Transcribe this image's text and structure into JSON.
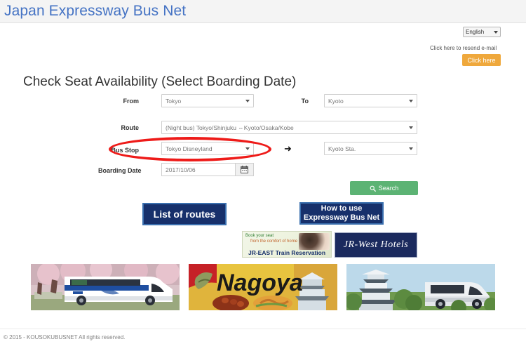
{
  "header": {
    "site_title": "Japan Expressway Bus Net"
  },
  "topbar": {
    "language_selected": "English",
    "resend_text": "Click here to resend e-mail",
    "click_here_label": "Click here"
  },
  "main": {
    "page_title": "Check Seat Availability (Select Boarding Date)"
  },
  "form": {
    "from_label": "From",
    "from_value": "Tokyo",
    "to_label": "To",
    "to_value": "Kyoto",
    "route_label": "Route",
    "route_value": "(Night bus) Tokyo/Shinjuku ⇔Kyoto/Osaka/Kobe",
    "bus_stop_label": "Bus Stop",
    "bus_stop_origin_value": "Tokyo Disneyland",
    "bus_stop_arrow": "➜",
    "bus_stop_dest_value": "Kyoto Sta.",
    "boarding_date_label": "Boarding Date",
    "boarding_date_value": "2017/10/06",
    "calendar_icon": "calendar-icon",
    "search_label": "Search",
    "search_icon": "search-icon"
  },
  "buttons": {
    "list_of_routes": "List of routes",
    "how_to_use_line1": "How to use",
    "how_to_use_line2": "Expressway Bus Net"
  },
  "banners": {
    "jreast_tagline_1": "Book your seat",
    "jreast_tagline_2": "from the comfort of home",
    "jreast_title": "JR-EAST Train Reservation",
    "jrwest_title": "JR-West Hotels"
  },
  "photos": [
    {
      "name": "bus-with-cherry-blossoms"
    },
    {
      "name": "nagoya-travel-collage"
    },
    {
      "name": "castle-with-express-bus"
    }
  ],
  "footer": {
    "copyright": "© 2015 - KOUSOKUBUSNET All rights reserved."
  },
  "colors": {
    "title_blue": "#4573c4",
    "header_bg": "#f4f4f4",
    "orange_button": "#efa83c",
    "green_button": "#5cb374",
    "navy_button": "#17306b",
    "navy_border": "#3a6fae",
    "annotation_red": "#ee1b19"
  }
}
